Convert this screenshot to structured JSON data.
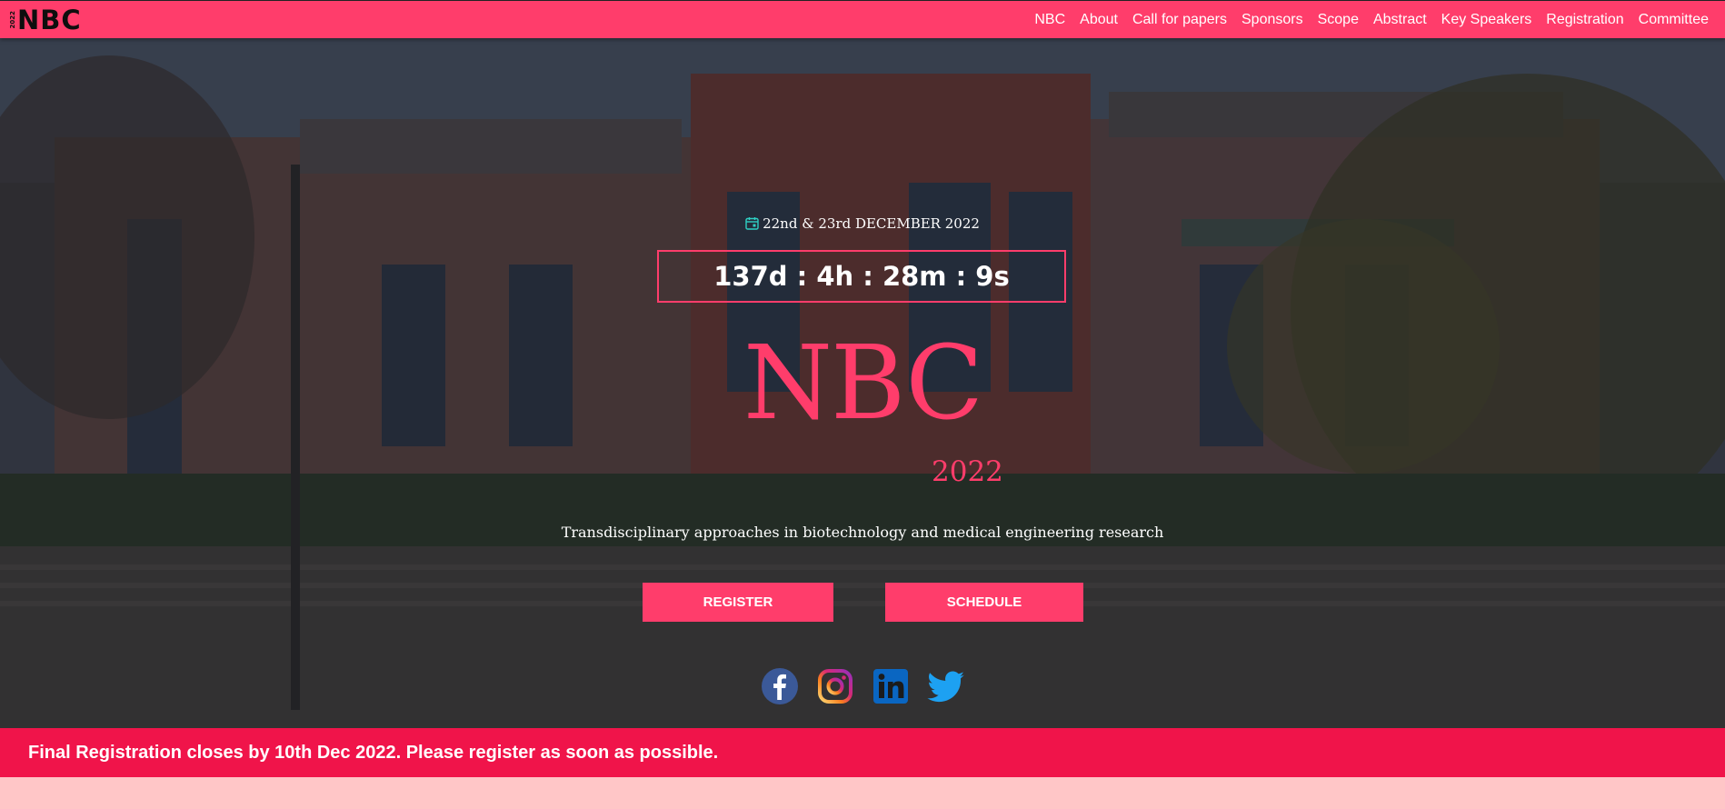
{
  "navbar": {
    "brand": "NBC",
    "brand_year": "2022",
    "links": [
      "NBC",
      "About",
      "Call for papers",
      "Sponsors",
      "Scope",
      "Abstract",
      "Key Speakers",
      "Registration",
      "Committee"
    ]
  },
  "hero": {
    "date": "22nd & 23rd DECEMBER 2022",
    "countdown": "137d : 4h : 28m : 9s",
    "title": "NBC",
    "year": "2022",
    "subtitle": "Transdisciplinary approaches in biotechnology and medical engineering research",
    "register_label": "REGISTER",
    "schedule_label": "SCHEDULE",
    "socials": [
      "facebook-icon",
      "instagram-icon",
      "linkedin-icon",
      "twitter-icon"
    ]
  },
  "announcement": {
    "text": "Final Registration closes by 10th Dec 2022. Please register as soon as possible."
  },
  "colors": {
    "accent": "#ff3d6b",
    "announce_bg": "#f0144a",
    "page_bg": "#ffc6c7"
  }
}
